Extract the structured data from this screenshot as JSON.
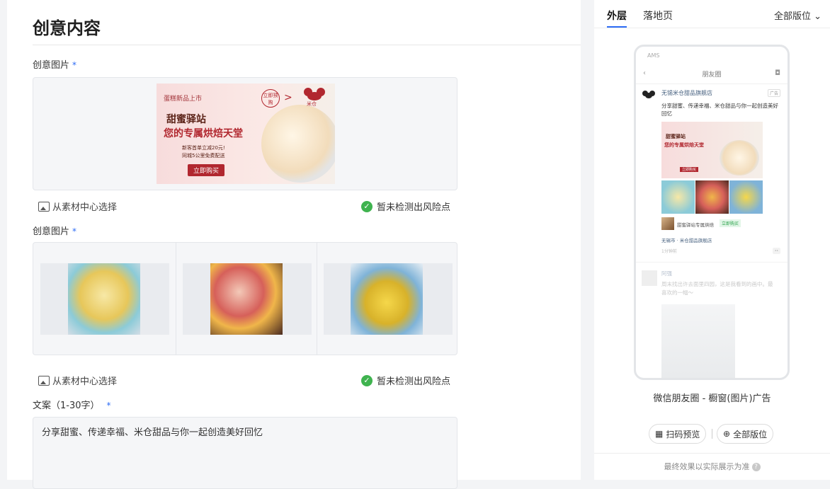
{
  "page_title": "创意内容",
  "section1": {
    "label": "创意图片",
    "required": "*",
    "from_library": "从素材中心选择",
    "risk_status": "暂未检测出风险点"
  },
  "banner": {
    "line1": "蛋糕新品上市",
    "line2": "甜蜜驿站",
    "line3": "您的专属烘焙天堂",
    "line4": "新客首单立减20元!",
    "line5": "同城5公里免费配送",
    "cta": "立即购买",
    "badge": "立即预购",
    "brand": "米仓"
  },
  "section2": {
    "label": "创意图片",
    "required": "*",
    "from_library": "从素材中心选择",
    "risk_status": "暂未检测出风险点"
  },
  "copy": {
    "label": "文案（1-30字）",
    "required": "*",
    "value": "分享甜蜜、传递幸福、米仓甜品与你一起创造美好回忆"
  },
  "preview": {
    "tabs": [
      {
        "label": "外层"
      },
      {
        "label": "落地页"
      }
    ],
    "layout_select": "全部版位",
    "phone": {
      "status_left": "AMS",
      "nav_title": "朋友圈",
      "advertiser": "无锡米仓甜品旗舰店",
      "ad_tag": "广告",
      "text": "分享甜蜜、传递幸福、米仓甜品与你一起创造美好回忆",
      "product_name": "甜蜜驿站专属烘焙",
      "buy_label": "立即购买",
      "location": "无锡市 · 米仓甜品旗舰店",
      "time": "1分钟前",
      "more": "··",
      "friend_name": "阿强",
      "friend_text": "周末找出许去面里四园，这是我看到的画中。最喜欢的一幅～"
    },
    "caption": "微信朋友圈 - 橱窗(图片)广告",
    "scan_btn": "扫码预览",
    "all_btn": "全部版位",
    "footnote": "最终效果以实际展示为准",
    "help": "?"
  },
  "colors": {
    "accent": "#2c6cf5",
    "success": "#3fb34f",
    "brand_red": "#b1272f"
  },
  "icons": [
    "image-library-icon",
    "check-circle-icon",
    "chevron-down-icon",
    "qr-code-icon",
    "zoom-plus-icon",
    "help-icon"
  ]
}
